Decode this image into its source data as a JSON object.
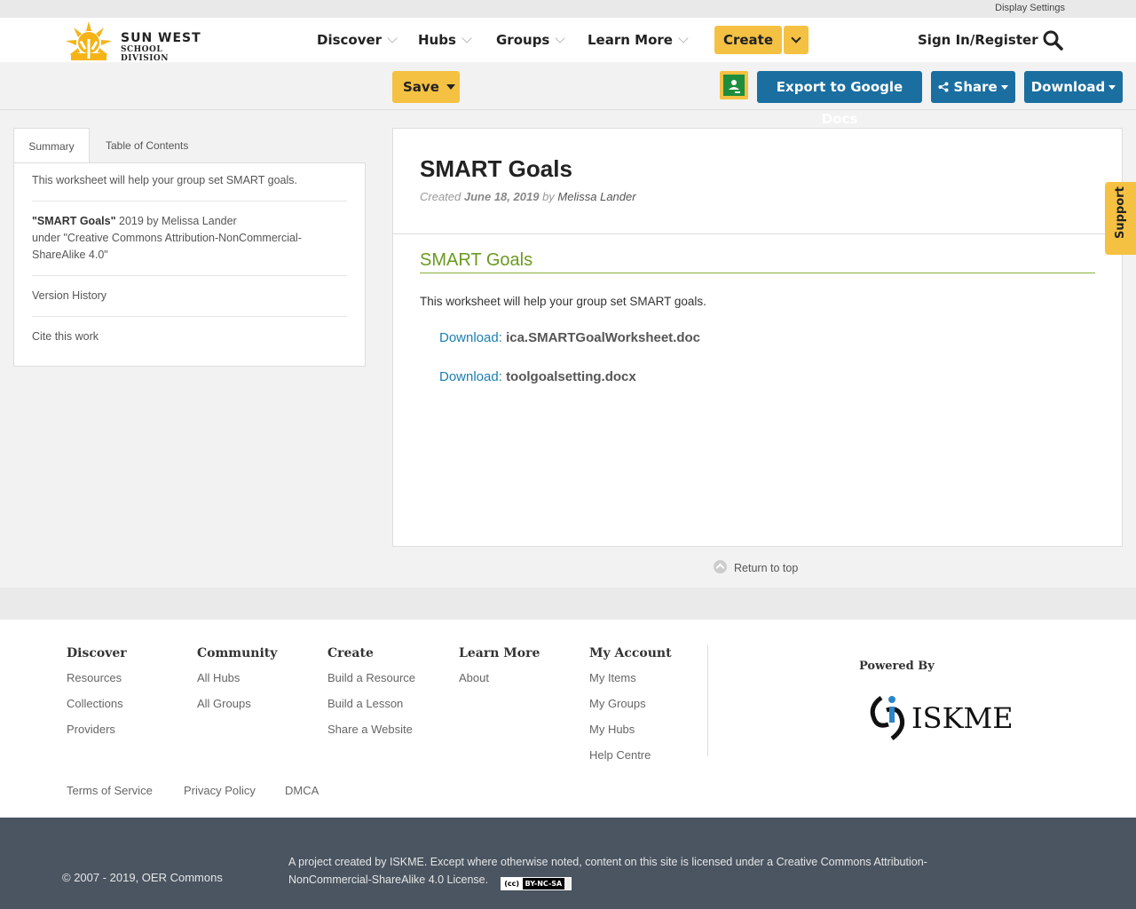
{
  "top_bar": {
    "display_settings": "Display Settings"
  },
  "brand": {
    "name": "SUN WEST",
    "sub": "SCHOOL DIVISION"
  },
  "nav": {
    "items": [
      "Discover",
      "Hubs",
      "Groups",
      "Learn More"
    ],
    "create": "Create",
    "signin": "Sign In/Register"
  },
  "toolbar": {
    "save": "Save",
    "export": "Export to Google Docs",
    "share": "Share",
    "download": "Download"
  },
  "sidebar": {
    "tabs": [
      "Summary",
      "Table of Contents"
    ],
    "summary": "This worksheet will help your group set SMART goals.",
    "attribution": {
      "title": "\"SMART Goals\"",
      "year_by": "2019 by Melissa Lander",
      "under": "under",
      "license": "\"Creative Commons Attribution-NonCommercial-ShareAlike 4.0\""
    },
    "version_history": "Version History",
    "cite": "Cite this work"
  },
  "resource": {
    "title": "SMART Goals",
    "created_label": "Created",
    "created_date": "June 18, 2019",
    "by_label": "by",
    "author": "Melissa Lander",
    "section_title": "SMART Goals",
    "description": "This worksheet will help your group set SMART goals.",
    "downloads": [
      {
        "label": "Download:",
        "file": "ica.SMARTGoalWorksheet.doc"
      },
      {
        "label": "Download:",
        "file": "toolgoalsetting.docx"
      }
    ],
    "return_top": "Return to top"
  },
  "support": "Support",
  "footer": {
    "columns": [
      {
        "head": "Discover",
        "links": [
          "Resources",
          "Collections",
          "Providers"
        ]
      },
      {
        "head": "Community",
        "links": [
          "All Hubs",
          "All Groups"
        ]
      },
      {
        "head": "Create",
        "links": [
          "Build a Resource",
          "Build a Lesson",
          "Share a Website"
        ]
      },
      {
        "head": "Learn More",
        "links": [
          "About"
        ]
      },
      {
        "head": "My Account",
        "links": [
          "My Items",
          "My Groups",
          "My Hubs",
          "Help Centre"
        ]
      }
    ],
    "powered_by": "Powered By",
    "iskme_logo": "ISKME",
    "legal": [
      "Terms of Service",
      "Privacy Policy",
      "DMCA"
    ],
    "copyright": "© 2007 - 2019, OER Commons",
    "project": "A project created by ISKME. Except where otherwise noted, content on this site is licensed under a Creative Commons Attribution-NonCommercial-ShareAlike 4.0 License.",
    "cc_badge": "BY-NC-SA"
  },
  "colors": {
    "accent_yellow": "#f5c142",
    "button_blue": "#1a6fa0",
    "section_green": "#6a9a1f",
    "link_blue": "#1a7fb0",
    "bottom_bar": "#4a5561"
  }
}
